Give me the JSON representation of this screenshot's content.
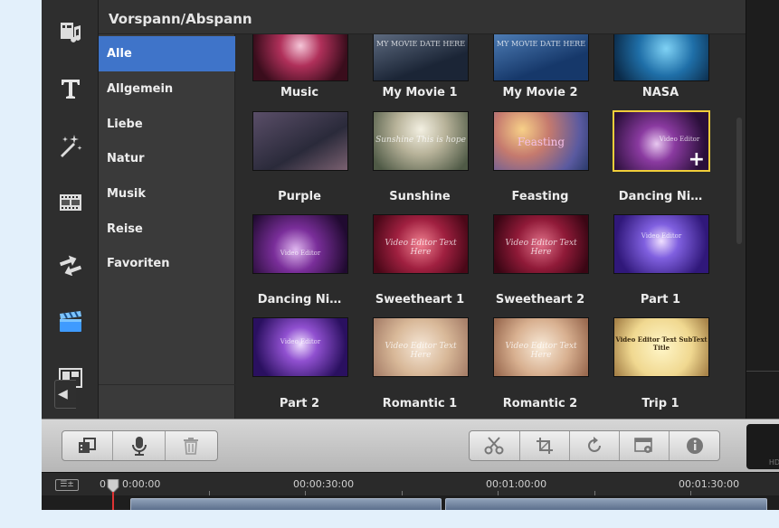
{
  "panel": {
    "title": "Vorspann/Abspann"
  },
  "categories": [
    {
      "label": "Alle",
      "selected": true
    },
    {
      "label": "Allgemein",
      "selected": false
    },
    {
      "label": "Liebe",
      "selected": false
    },
    {
      "label": "Natur",
      "selected": false
    },
    {
      "label": "Musik",
      "selected": false
    },
    {
      "label": "Reise",
      "selected": false
    },
    {
      "label": "Favoriten",
      "selected": false
    }
  ],
  "sidebar_tools": [
    {
      "icon": "music-library-icon"
    },
    {
      "icon": "text-icon"
    },
    {
      "icon": "magic-wand-effects-icon"
    },
    {
      "icon": "film-frames-icon"
    },
    {
      "icon": "transitions-icon"
    },
    {
      "icon": "clapperboard-titles-icon",
      "active": true
    },
    {
      "icon": "picture-in-picture-icon"
    }
  ],
  "templates": [
    {
      "label": "Music",
      "thumb_text": ""
    },
    {
      "label": "My Movie 1",
      "thumb_text": "MY MOVIE DATE HERE"
    },
    {
      "label": "My Movie 2",
      "thumb_text": "MY MOVIE DATE HERE"
    },
    {
      "label": "NASA",
      "thumb_text": ""
    },
    {
      "label": "Purple",
      "thumb_text": ""
    },
    {
      "label": "Sunshine",
      "thumb_text": "Sunshine This is hope"
    },
    {
      "label": "Feasting",
      "thumb_text": "Feasting"
    },
    {
      "label": "Dancing Ni…",
      "thumb_text": "Video Editor",
      "selected": true
    },
    {
      "label": "Dancing Ni…",
      "thumb_text": "Video Editor"
    },
    {
      "label": "Sweetheart 1",
      "thumb_text": "Video Editor Text Here"
    },
    {
      "label": "Sweetheart 2",
      "thumb_text": "Video Editor Text Here"
    },
    {
      "label": "Part 1",
      "thumb_text": "Video Editor"
    },
    {
      "label": "Part 2",
      "thumb_text": "Video Editor"
    },
    {
      "label": "Romantic 1",
      "thumb_text": "Video Editor Text Here"
    },
    {
      "label": "Romantic 2",
      "thumb_text": "Video Editor Text Here"
    },
    {
      "label": "Trip 1",
      "thumb_text": "Video Editor Text SubText Title"
    }
  ],
  "toolbar": {
    "left_group": [
      "media-import-icon",
      "microphone-icon",
      "trash-icon"
    ],
    "right_group": [
      "scissors-icon",
      "crop-icon",
      "rotate-icon",
      "settings-icon",
      "info-icon"
    ],
    "hd_label": "HD"
  },
  "timeline": {
    "zoom_label": "☰±",
    "start_marker": "0",
    "timecodes": [
      "0:00:00",
      "00:00:30:00",
      "00:01:00:00",
      "00:01:30:00"
    ]
  },
  "colors": {
    "accent": "#3f74c9",
    "selection": "#f0cd3a",
    "active_tool": "#4aa8ff"
  }
}
